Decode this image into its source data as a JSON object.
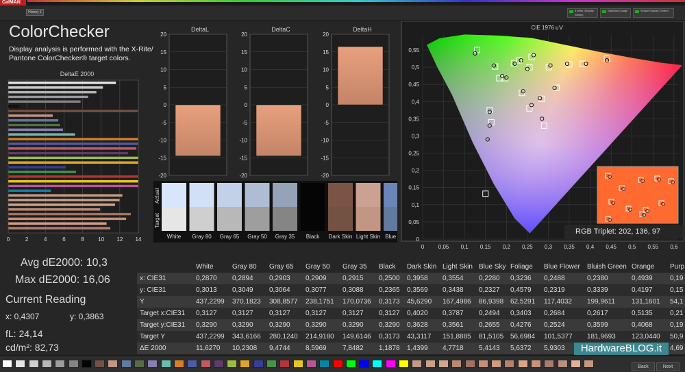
{
  "app": {
    "logo": "CalMAN",
    "tab": "History 1"
  },
  "header": {
    "dropdowns": [
      "4 Wise (Display Select)",
      "Standard Gauge",
      "Simple Display Control"
    ]
  },
  "colorchecker": {
    "title": "ColorChecker",
    "description": "Display analysis is performed with the X-Rite/ Pantone ColorChecker® target colors.",
    "de2000_title": "DeltaE 2000",
    "de2000_ticks": [
      "0",
      "2",
      "4",
      "6",
      "8",
      "10",
      "12",
      "14"
    ],
    "de2000_bars": [
      {
        "v": 11.6,
        "c": "#e6e6e6"
      },
      {
        "v": 10.2,
        "c": "#cccccc"
      },
      {
        "v": 9.5,
        "c": "#b3b3b3"
      },
      {
        "v": 8.6,
        "c": "#999999"
      },
      {
        "v": 7.8,
        "c": "#808080"
      },
      {
        "v": 1.2,
        "c": "#111111"
      },
      {
        "v": 14.4,
        "c": "#735244"
      },
      {
        "v": 4.8,
        "c": "#c29682"
      },
      {
        "v": 5.4,
        "c": "#627a9d"
      },
      {
        "v": 5.6,
        "c": "#576c43"
      },
      {
        "v": 5.9,
        "c": "#8580b1"
      },
      {
        "v": 7.2,
        "c": "#67bdaa"
      },
      {
        "v": 16.1,
        "c": "#d67e2c"
      },
      {
        "v": 14.1,
        "c": "#505ba6"
      },
      {
        "v": 13.8,
        "c": "#c15a63"
      },
      {
        "v": 12.9,
        "c": "#5e3c6c"
      },
      {
        "v": 14.9,
        "c": "#9dbc40"
      },
      {
        "v": 15.2,
        "c": "#e0a32e"
      },
      {
        "v": 6.2,
        "c": "#383d96"
      },
      {
        "v": 7.3,
        "c": "#469449"
      },
      {
        "v": 15.8,
        "c": "#af363c"
      },
      {
        "v": 14.7,
        "c": "#e7c71f"
      },
      {
        "v": 15.5,
        "c": "#bb5695"
      },
      {
        "v": 4.6,
        "c": "#0885a1"
      },
      {
        "v": 12.3,
        "c": "#c39a86"
      },
      {
        "v": 12.0,
        "c": "#c8a08c"
      },
      {
        "v": 11.5,
        "c": "#d1a58e"
      },
      {
        "v": 9.9,
        "c": "#b88a73"
      },
      {
        "v": 13.2,
        "c": "#a27262"
      },
      {
        "v": 12.7,
        "c": "#c58e77"
      },
      {
        "v": 10.6,
        "c": "#ce9b82"
      },
      {
        "v": 11.0,
        "c": "#b28170"
      }
    ]
  },
  "delta": {
    "L": {
      "title": "DeltaL",
      "ticks": [
        "20",
        "15",
        "10",
        "5",
        "0",
        "-5",
        "-10",
        "-15",
        "-20"
      ],
      "value": -14.5
    },
    "C": {
      "title": "DeltaC",
      "ticks": [
        "20",
        "15",
        "10",
        "5",
        "0",
        "-5",
        "-10",
        "-15",
        "-20"
      ],
      "value": -14.5
    },
    "H": {
      "title": "DeltaH",
      "ticks": [
        "20",
        "15",
        "10",
        "5",
        "0",
        "-5",
        "-10",
        "-15",
        "-20"
      ],
      "value": 16.5
    }
  },
  "swatches": {
    "actual_label": "Actual",
    "target_label": "Target",
    "items": [
      {
        "name": "White",
        "actual": "#d8e6fb",
        "target": "#e6e6e6"
      },
      {
        "name": "Gray 80",
        "actual": "#d2e0f6",
        "target": "#cfcfcf"
      },
      {
        "name": "Gray 65",
        "actual": "#c2d1e9",
        "target": "#b8b8b8"
      },
      {
        "name": "Gray 50",
        "actual": "#aebdd4",
        "target": "#9e9e9e"
      },
      {
        "name": "Gray 35",
        "actual": "#95a3b9",
        "target": "#858585"
      },
      {
        "name": "Black",
        "actual": "#050505",
        "target": "#050505"
      },
      {
        "name": "Dark Skin",
        "actual": "#7b5446",
        "target": "#735244"
      },
      {
        "name": "Light Skin",
        "actual": "#cba292",
        "target": "#c29682"
      },
      {
        "name": "Blue Sky",
        "actual": "#6a86b8",
        "target": "#627a9d"
      }
    ]
  },
  "cie": {
    "title": "CIE 1976 u'v'",
    "x_ticks": [
      "0",
      "0,05",
      "0,1",
      "0,15",
      "0,2",
      "0,25",
      "0,3",
      "0,35",
      "0,4",
      "0,45",
      "0,5",
      "0,55",
      "0,6"
    ],
    "y_ticks": [
      "0,55",
      "0,5",
      "0,45",
      "0,4",
      "0,35",
      "0,3",
      "0,25",
      "0,2",
      "0,15",
      "0,1",
      "0,05",
      "0"
    ],
    "rgb_triplet": "RGB Triplet: 202, 136, 97"
  },
  "stats": {
    "avg_label": "Avg dE2000: 10,3",
    "max_label": "Max dE2000: 16,06",
    "current_title": "Current Reading",
    "x": "x: 0,4307",
    "y": "y: 0,3863",
    "fl": "fL: 24,14",
    "cd": "cd/m²: 82,73"
  },
  "table": {
    "columns": [
      "White",
      "Gray 80",
      "Gray 65",
      "Gray 50",
      "Gray 35",
      "Black",
      "Dark Skin",
      "Light Skin",
      "Blue Sky",
      "Foliage",
      "Blue Flower",
      "Bluish Green",
      "Orange",
      "Purp"
    ],
    "rows": [
      {
        "label": "x: CIE31",
        "values": [
          "0,2870",
          "0,2894",
          "0,2903",
          "0,2909",
          "0,2915",
          "0,2500",
          "0,3958",
          "0,3554",
          "0,2280",
          "0,3236",
          "0,2488",
          "0,2380",
          "0,4939",
          "0,19"
        ]
      },
      {
        "label": "y: CIE31",
        "values": [
          "0,3013",
          "0,3049",
          "0,3064",
          "0,3077",
          "0,3088",
          "0,2365",
          "0,3569",
          "0,3438",
          "0,2327",
          "0,4579",
          "0,2319",
          "0,3339",
          "0,4197",
          "0,15"
        ]
      },
      {
        "label": "Y",
        "values": [
          "437,2299",
          "370,1823",
          "308,8577",
          "238,1751",
          "170,0736",
          "0,3173",
          "45,6290",
          "167,4986",
          "86,9398",
          "62,5291",
          "117,4032",
          "199,9611",
          "131,1601",
          "54,1"
        ]
      },
      {
        "label": "Target x:CIE31",
        "values": [
          "0,3127",
          "0,3127",
          "0,3127",
          "0,3127",
          "0,3127",
          "0,3127",
          "0,4020",
          "0,3787",
          "0,2494",
          "0,3403",
          "0,2684",
          "0,2617",
          "0,5135",
          "0,21"
        ]
      },
      {
        "label": "Target y:CIE31",
        "values": [
          "0,3290",
          "0,3290",
          "0,3290",
          "0,3290",
          "0,3290",
          "0,3290",
          "0,3628",
          "0,3561",
          "0,2655",
          "0,4276",
          "0,2524",
          "0,3599",
          "0,4068",
          "0,19"
        ]
      },
      {
        "label": "Target Y",
        "values": [
          "437,2299",
          "343,6166",
          "280,1240",
          "214,9180",
          "149,6146",
          "0,3173",
          "43,3117",
          "151,8885",
          "81,5105",
          "56,6984",
          "101,5377",
          "181,9693",
          "123,0440",
          "50,9"
        ]
      },
      {
        "label": "ΔE 2000",
        "values": [
          "11,6270",
          "10,2308",
          "9,4744",
          "8,5969",
          "7,8482",
          "1,1878",
          "1,4399",
          "4,7718",
          "5,4143",
          "5,6372",
          "5,9303",
          "7,1999",
          "4,7373",
          "4,69"
        ]
      }
    ]
  },
  "footer": {
    "colors": [
      "#ffffff",
      "#e6e6e6",
      "#cfcfcf",
      "#b8b8b8",
      "#9e9e9e",
      "#858585",
      "#050505",
      "#735244",
      "#c29682",
      "#627a9d",
      "#576c43",
      "#8580b1",
      "#67bdaa",
      "#d67e2c",
      "#505ba6",
      "#c15a63",
      "#5e3c6c",
      "#9dbc40",
      "#e0a32e",
      "#383d96",
      "#469449",
      "#af363c",
      "#e7c71f",
      "#bb5695",
      "#0885a1",
      "#ff0000",
      "#00ff00",
      "#0000ff",
      "#00ffff",
      "#ff00ff",
      "#ffff00",
      "#c39a86",
      "#c8a08c",
      "#d1a58e",
      "#b88a73",
      "#a27262",
      "#c58e77",
      "#ce9b82",
      "#b28170",
      "#d9a58a",
      "#c7937c",
      "#a77d6c",
      "#b98f7d",
      "#e1b098",
      "#c3987f"
    ],
    "back": "Back",
    "next": "Next"
  },
  "watermark": "HardwareBLOG.it"
}
